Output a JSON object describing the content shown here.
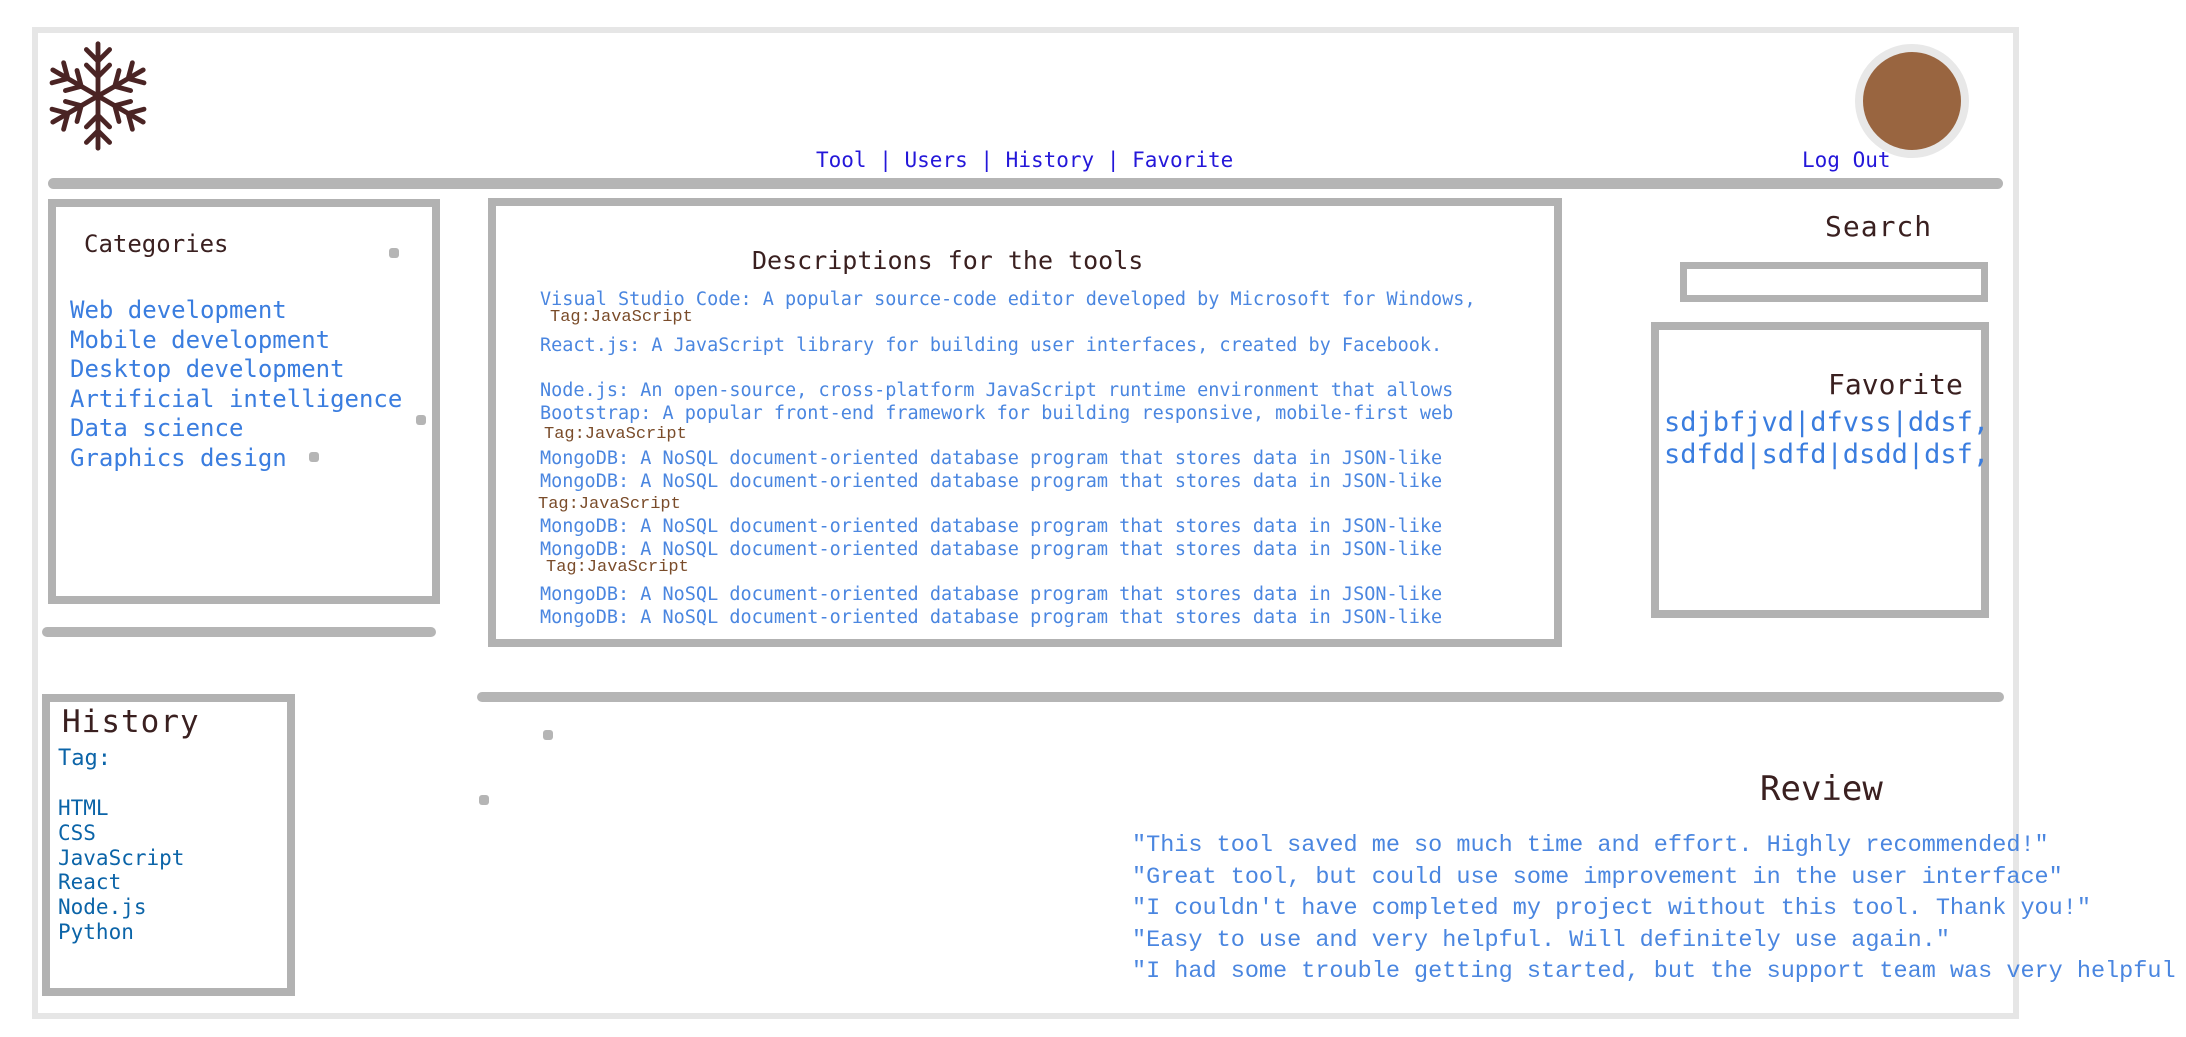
{
  "header": {
    "logo_icon": "snowflake-icon",
    "avatar_color": "#996540",
    "nav": [
      "Tool",
      "Users",
      "History",
      "Favorite"
    ],
    "nav_separator": " | ",
    "logout": "Log Out"
  },
  "categories": {
    "title": "Categories",
    "items": [
      "Web development",
      "Mobile development",
      "Desktop development",
      "Artificial intelligence",
      "Data science",
      "Graphics design"
    ]
  },
  "descriptions": {
    "title": "Descriptions for the tools",
    "items": [
      "Visual Studio Code: A popular source-code editor developed by Microsoft for Windows,",
      "Tag:JavaScript",
      "React.js: A JavaScript library for building user interfaces, created by Facebook.",
      "Node.js: An open-source, cross-platform JavaScript runtime environment that allows",
      "Bootstrap: A popular front-end framework for building responsive, mobile-first web",
      "Tag:JavaScript",
      "MongoDB: A NoSQL document-oriented database program that stores data in JSON-like",
      "MongoDB: A NoSQL document-oriented database program that stores data in JSON-like",
      "Tag:JavaScript",
      "MongoDB: A NoSQL document-oriented database program that stores data in JSON-like",
      "MongoDB: A NoSQL document-oriented database program that stores data in JSON-like",
      "Tag:JavaScript",
      "MongoDB: A NoSQL document-oriented database program that stores data in JSON-like",
      "MongoDB: A NoSQL document-oriented database program that stores data in JSON-like"
    ]
  },
  "search": {
    "title": "Search",
    "value": ""
  },
  "favorite": {
    "title": "Favorite",
    "lines": [
      "sdjbfjvd|dfvss|ddsf,",
      "sdfdd|sdfd|dsdd|dsf,"
    ]
  },
  "history": {
    "title": "History",
    "tag_label": "Tag:",
    "items": [
      "HTML",
      "CSS",
      "JavaScript",
      "React",
      "Node.js",
      "Python"
    ]
  },
  "review": {
    "title": "Review",
    "items": [
      "\"This tool saved me so much time and effort. Highly recommended!\"",
      "\"Great tool, but could use some improvement in the user interface\"",
      "\"I couldn't have completed my project without this tool. Thank you!\"",
      "\"Easy to use and very helpful. Will definitely use again.\"",
      "\"I had some trouble getting started, but the support team was very helpful"
    ]
  },
  "colors": {
    "link": "#3a7ddf",
    "nav": "#2417d9",
    "tag": "#7a4c2a",
    "heading": "#3a2020",
    "border": "#b2b2b2"
  }
}
